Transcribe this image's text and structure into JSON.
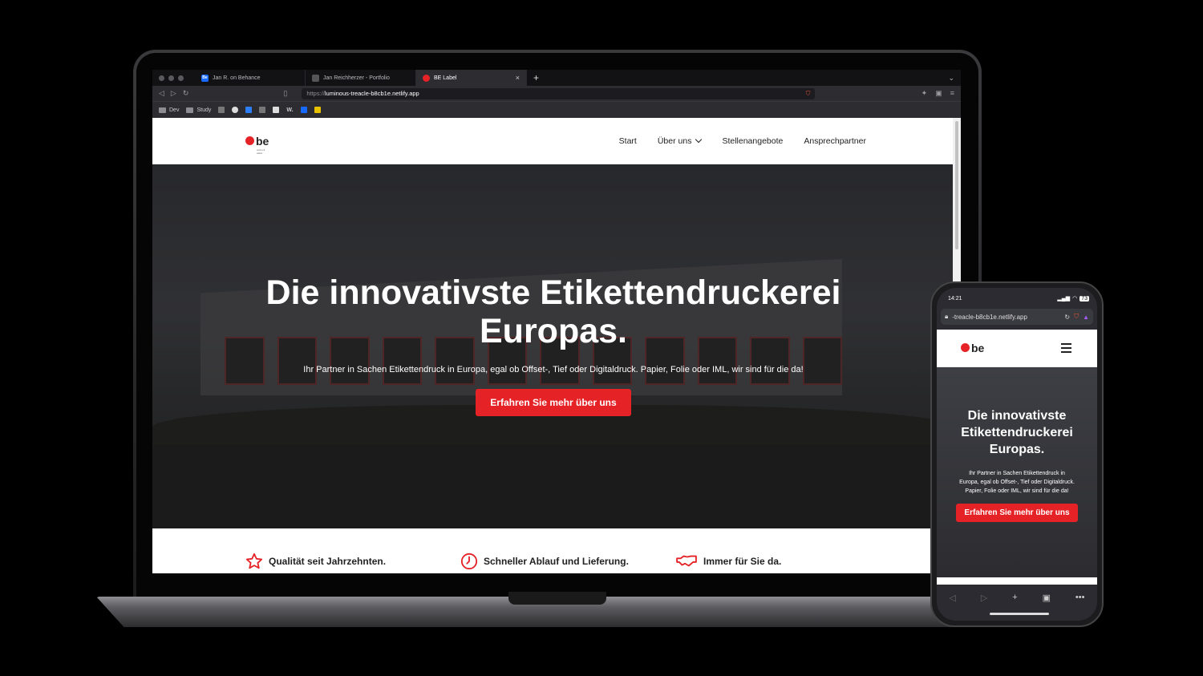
{
  "browser": {
    "tabs": [
      {
        "label": "Jan R. on Behance",
        "favicon": "Be",
        "active": false
      },
      {
        "label": "Jan Reichherzer - Portfolio",
        "favicon": "",
        "active": false
      },
      {
        "label": "BE Label",
        "favicon": "",
        "active": true
      }
    ],
    "url_scheme": "https://",
    "url_host": "luminous-treacle-b8cb1e.netlify.app",
    "bookmarks": [
      "Dev",
      "Study",
      "W."
    ]
  },
  "site": {
    "logo_text": "be",
    "logo_sub": "verbu & etiket",
    "nav": [
      "Start",
      "Über uns",
      "Stellenangebote",
      "Ansprechpartner"
    ],
    "hero": {
      "title": "Die innovativste Etikettendruckerei Europas.",
      "subtitle": "Ihr Partner in Sachen Etikettendruck in Europa, egal ob Offset-, Tief oder Digitaldruck. Papier, Folie oder IML, wir sind für die da!",
      "cta": "Erfahren Sie mehr über uns"
    },
    "features": [
      {
        "icon": "star-icon",
        "label": "Qualität seit Jahrzehnten."
      },
      {
        "icon": "clock-icon",
        "label": "Schneller Ablauf und Lieferung."
      },
      {
        "icon": "handshake-icon",
        "label": "Immer für Sie da."
      }
    ]
  },
  "phone": {
    "time": "14:21",
    "battery": "73",
    "url": "-treacle-b8cb1e.netlify.app",
    "hero_title": "Die innovativste Etikettendruckerei Europas.",
    "hero_subtitle": "Ihr Partner in Sachen Etikettendruck in Europa, egal ob Offset-, Tief oder Digitaldruck. Papier, Folie oder IML, wir sind für die da!",
    "cta": "Erfahren Sie mehr über uns"
  },
  "colors": {
    "brand_red": "#e52327",
    "dark": "#222222"
  }
}
